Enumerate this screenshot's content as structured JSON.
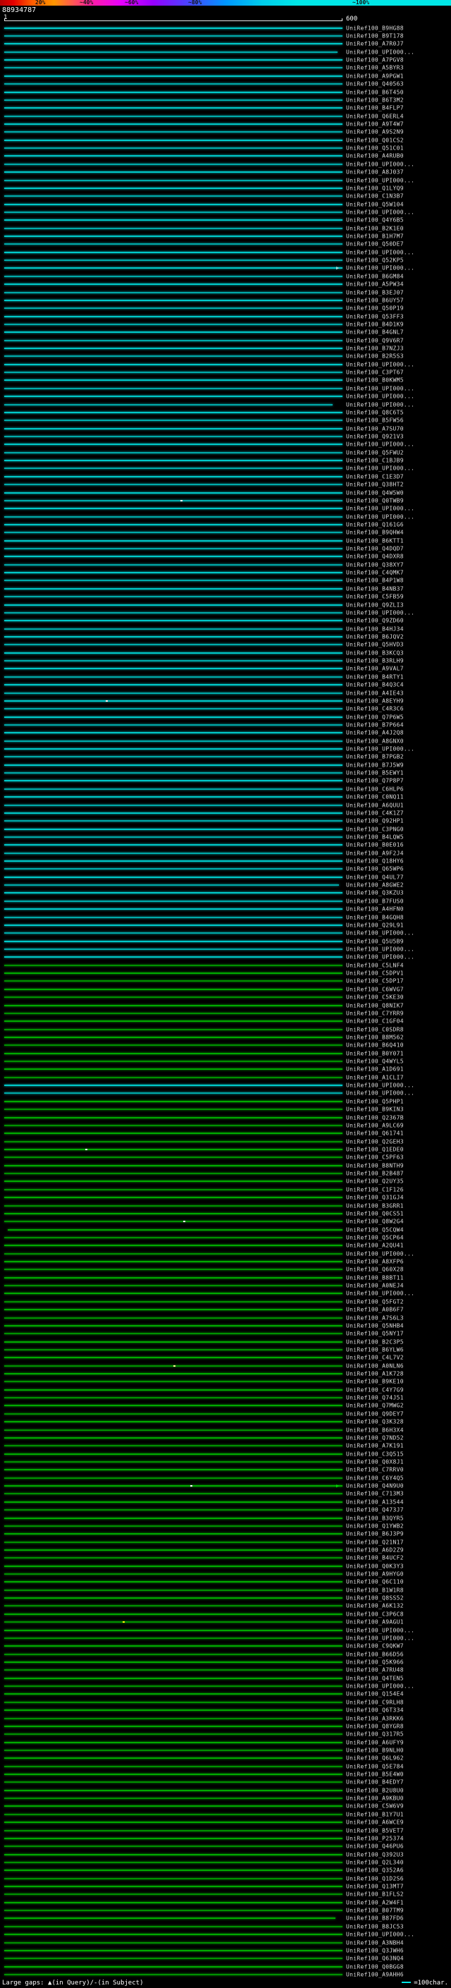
{
  "chart_data": {
    "type": "bar",
    "orientation": "horizontal",
    "title": "88934787",
    "x_range": [
      1,
      600
    ],
    "xlabel": "",
    "ylabel": "",
    "grid": false,
    "legend_position": "top",
    "scale_labels": [
      "20%",
      "~40%",
      "~60%",
      "~80%",
      "~100%"
    ],
    "colors": {
      "c": "#00c8c8",
      "g": "#00aa00"
    },
    "subject_prefix": "UniRef100_",
    "hits": [
      {
        "s": "B9HG88",
        "c": "c"
      },
      {
        "s": "B9T178",
        "c": "c"
      },
      {
        "s": "A7R0J7",
        "c": "c"
      },
      {
        "s": "UPI000...",
        "c": "c",
        "x1": 0.985
      },
      {
        "s": "A7PGV8",
        "c": "c"
      },
      {
        "s": "A5BYR3",
        "c": "c"
      },
      {
        "s": "A9PGW1",
        "c": "c"
      },
      {
        "s": "Q40563",
        "c": "c"
      },
      {
        "s": "B6T450",
        "c": "c"
      },
      {
        "s": "B6T3M2",
        "c": "c"
      },
      {
        "s": "B4FLP7",
        "c": "c"
      },
      {
        "s": "Q6ERL4",
        "c": "c"
      },
      {
        "s": "A9T4W7",
        "c": "c"
      },
      {
        "s": "A9S2N9",
        "c": "c"
      },
      {
        "s": "Q01CS2",
        "c": "c"
      },
      {
        "s": "Q51C01",
        "c": "c"
      },
      {
        "s": "A4RUB0",
        "c": "c"
      },
      {
        "s": "UPI000...",
        "c": "c"
      },
      {
        "s": "A8J037",
        "c": "c"
      },
      {
        "s": "UPI000...",
        "c": "c"
      },
      {
        "s": "Q1LYQ9",
        "c": "c"
      },
      {
        "s": "C1N3B7",
        "c": "c"
      },
      {
        "s": "Q5W104",
        "c": "c"
      },
      {
        "s": "UPI000...",
        "c": "c"
      },
      {
        "s": "Q4Y6B5",
        "c": "c"
      },
      {
        "s": "B2K1E0",
        "c": "c"
      },
      {
        "s": "B1H7M7",
        "c": "c"
      },
      {
        "s": "Q50DE7",
        "c": "c"
      },
      {
        "s": "UPI000...",
        "c": "c"
      },
      {
        "s": "Q52KP5",
        "c": "c"
      },
      {
        "s": "UPI000...",
        "c": "c",
        "m": "#a0e6e6"
      },
      {
        "s": "B6GM84",
        "c": "c"
      },
      {
        "s": "A5PW34",
        "c": "c"
      },
      {
        "s": "B3EJ07",
        "c": "c"
      },
      {
        "s": "B6UY57",
        "c": "c"
      },
      {
        "s": "Q50P19",
        "c": "c"
      },
      {
        "s": "Q53FF3",
        "c": "c"
      },
      {
        "s": "B4D1K9",
        "c": "c"
      },
      {
        "s": "B4GNL7",
        "c": "c"
      },
      {
        "s": "Q9V6R7",
        "c": "c"
      },
      {
        "s": "B7NZJ3",
        "c": "c"
      },
      {
        "s": "B2R5S3",
        "c": "c"
      },
      {
        "s": "UPI000...",
        "c": "c"
      },
      {
        "s": "C3PT67",
        "c": "c"
      },
      {
        "s": "B0KWM5",
        "c": "c"
      },
      {
        "s": "UPI000...",
        "c": "c"
      },
      {
        "s": "UPI000...",
        "c": "c"
      },
      {
        "s": "UPI000...",
        "c": "c",
        "x1": 0.97
      },
      {
        "s": "Q8C6T5",
        "c": "c"
      },
      {
        "s": "B5FW56",
        "c": "c"
      },
      {
        "s": "A7SU70",
        "c": "c"
      },
      {
        "s": "Q921V3",
        "c": "c"
      },
      {
        "s": "UPI000...",
        "c": "c"
      },
      {
        "s": "Q5FWU2",
        "c": "c"
      },
      {
        "s": "C1BJB9",
        "c": "c"
      },
      {
        "s": "UPI000...",
        "c": "c"
      },
      {
        "s": "C1E3D7",
        "c": "c"
      },
      {
        "s": "Q38HT2",
        "c": "c"
      },
      {
        "s": "Q4W5W0",
        "c": "c"
      },
      {
        "s": "Q0TWB9",
        "c": "c",
        "d": [
          [
            0.52,
            "#ffffff"
          ]
        ]
      },
      {
        "s": "UPI000...",
        "c": "c"
      },
      {
        "s": "UPI000...",
        "c": "c"
      },
      {
        "s": "Q161G6",
        "c": "c"
      },
      {
        "s": "B9QHW4",
        "c": "c"
      },
      {
        "s": "B6KTT1",
        "c": "c"
      },
      {
        "s": "Q4DQD7",
        "c": "c"
      },
      {
        "s": "Q4DXR8",
        "c": "c"
      },
      {
        "s": "Q38XY7",
        "c": "c"
      },
      {
        "s": "C4QMK7",
        "c": "c"
      },
      {
        "s": "B4P1W8",
        "c": "c"
      },
      {
        "s": "B4NB37",
        "c": "c"
      },
      {
        "s": "C5FB59",
        "c": "c"
      },
      {
        "s": "Q9ZLI3",
        "c": "c"
      },
      {
        "s": "UPI000...",
        "c": "c"
      },
      {
        "s": "Q9ZD60",
        "c": "c"
      },
      {
        "s": "B4HJ34",
        "c": "c"
      },
      {
        "s": "B6JQV2",
        "c": "c"
      },
      {
        "s": "Q5HVD3",
        "c": "c"
      },
      {
        "s": "B3KCQ3",
        "c": "c"
      },
      {
        "s": "B3RLH9",
        "c": "c"
      },
      {
        "s": "A9VAL7",
        "c": "c"
      },
      {
        "s": "B4RTY1",
        "c": "c"
      },
      {
        "s": "B4Q3C4",
        "c": "c"
      },
      {
        "s": "A4IE43",
        "c": "c"
      },
      {
        "s": "A8EYH9",
        "c": "c",
        "d": [
          [
            0.3,
            "#ffffff"
          ]
        ]
      },
      {
        "s": "C4R3C6",
        "c": "c"
      },
      {
        "s": "Q7P6W5",
        "c": "c"
      },
      {
        "s": "B7P664",
        "c": "c"
      },
      {
        "s": "A4J2Q8",
        "c": "c"
      },
      {
        "s": "A8GNX0",
        "c": "c"
      },
      {
        "s": "UPI000...",
        "c": "c"
      },
      {
        "s": "B7PGB2",
        "c": "c"
      },
      {
        "s": "B7J5W9",
        "c": "c"
      },
      {
        "s": "B5EWY1",
        "c": "c"
      },
      {
        "s": "Q7P8P7",
        "c": "c"
      },
      {
        "s": "C6HLP6",
        "c": "c"
      },
      {
        "s": "C0NQ11",
        "c": "c"
      },
      {
        "s": "A6QUU1",
        "c": "c"
      },
      {
        "s": "C4K1Z7",
        "c": "c"
      },
      {
        "s": "Q92HP1",
        "c": "c"
      },
      {
        "s": "C3PNG0",
        "c": "c"
      },
      {
        "s": "B4LQW5",
        "c": "c"
      },
      {
        "s": "B0E016",
        "c": "c"
      },
      {
        "s": "A9F2J4",
        "c": "c"
      },
      {
        "s": "Q18HY6",
        "c": "c"
      },
      {
        "s": "Q65WP6",
        "c": "c"
      },
      {
        "s": "Q4UL77",
        "c": "c"
      },
      {
        "s": "A8GWE2",
        "c": "c",
        "x1": 0.99
      },
      {
        "s": "Q3KZU3",
        "c": "c"
      },
      {
        "s": "B7FUS0",
        "c": "c"
      },
      {
        "s": "A4HFN0",
        "c": "c"
      },
      {
        "s": "B4GQH8",
        "c": "c"
      },
      {
        "s": "Q29L91",
        "c": "c"
      },
      {
        "s": "UPI000...",
        "c": "c"
      },
      {
        "s": "Q5U5B9",
        "c": "c"
      },
      {
        "s": "UPI000...",
        "c": "c"
      },
      {
        "s": "UPI000...",
        "c": "c"
      },
      {
        "s": "C5LNF4",
        "c": "g"
      },
      {
        "s": "C5DPV1",
        "c": "g"
      },
      {
        "s": "C5DP17",
        "c": "g"
      },
      {
        "s": "C6WVG7",
        "c": "g"
      },
      {
        "s": "C5KE30",
        "c": "g"
      },
      {
        "s": "Q8NIK7",
        "c": "g"
      },
      {
        "s": "C7YRR9",
        "c": "g"
      },
      {
        "s": "C1GF04",
        "c": "g"
      },
      {
        "s": "C0SDR8",
        "c": "g"
      },
      {
        "s": "B8M562",
        "c": "g"
      },
      {
        "s": "B6Q410",
        "c": "g"
      },
      {
        "s": "B0Y071",
        "c": "g"
      },
      {
        "s": "Q4WYL5",
        "c": "g"
      },
      {
        "s": "A1D691",
        "c": "g"
      },
      {
        "s": "A1CLI7",
        "c": "g"
      },
      {
        "s": "UPI000...",
        "c": "c"
      },
      {
        "s": "UPI000...",
        "c": "c"
      },
      {
        "s": "Q5PHP1",
        "c": "g"
      },
      {
        "s": "B9KIN3",
        "c": "g"
      },
      {
        "s": "Q2367B",
        "c": "g"
      },
      {
        "s": "A9LC69",
        "c": "g"
      },
      {
        "s": "Q61741",
        "c": "g"
      },
      {
        "s": "Q2GEH3",
        "c": "g"
      },
      {
        "s": "Q1EDE0",
        "c": "g",
        "d": [
          [
            0.24,
            "#ffffff"
          ]
        ]
      },
      {
        "s": "C5PF63",
        "c": "g"
      },
      {
        "s": "B8NTH9",
        "c": "g"
      },
      {
        "s": "B2B487",
        "c": "g"
      },
      {
        "s": "Q2UY35",
        "c": "g"
      },
      {
        "s": "C1F126",
        "c": "g"
      },
      {
        "s": "Q31GJ4",
        "c": "g"
      },
      {
        "s": "B3GRR1",
        "c": "g"
      },
      {
        "s": "Q0CS51",
        "c": "g"
      },
      {
        "s": "Q8W2G4",
        "c": "g",
        "d": [
          [
            0.53,
            "#ffffff"
          ]
        ]
      },
      {
        "s": "Q5CQW4",
        "c": "g",
        "x0": 0.01
      },
      {
        "s": "Q5CP64",
        "c": "g"
      },
      {
        "s": "A2QU41",
        "c": "g"
      },
      {
        "s": "UPI000...",
        "c": "g"
      },
      {
        "s": "A8XFP6",
        "c": "g"
      },
      {
        "s": "Q60X28",
        "c": "g"
      },
      {
        "s": "B8BT11",
        "c": "g"
      },
      {
        "s": "A0NEJ4",
        "c": "g"
      },
      {
        "s": "UPI000...",
        "c": "g"
      },
      {
        "s": "Q5FGT2",
        "c": "g"
      },
      {
        "s": "A0B6F7",
        "c": "g"
      },
      {
        "s": "A7S6L3",
        "c": "g"
      },
      {
        "s": "Q5NHB4",
        "c": "g"
      },
      {
        "s": "Q5NY17",
        "c": "g"
      },
      {
        "s": "B2C3P5",
        "c": "g"
      },
      {
        "s": "B6YLW6",
        "c": "g"
      },
      {
        "s": "C4L7V2",
        "c": "g"
      },
      {
        "s": "A0NLN6",
        "c": "g",
        "d": [
          [
            0.5,
            "#ffff99"
          ]
        ]
      },
      {
        "s": "A1K728",
        "c": "g"
      },
      {
        "s": "B9KE10",
        "c": "g"
      },
      {
        "s": "C4Y7G9",
        "c": "g"
      },
      {
        "s": "Q74J51",
        "c": "g"
      },
      {
        "s": "Q7MWG2",
        "c": "g"
      },
      {
        "s": "Q9DEY7",
        "c": "g"
      },
      {
        "s": "Q3K328",
        "c": "g"
      },
      {
        "s": "B6H3X4",
        "c": "g"
      },
      {
        "s": "Q7ND52",
        "c": "g"
      },
      {
        "s": "A7K191",
        "c": "g"
      },
      {
        "s": "C3Q515",
        "c": "g"
      },
      {
        "s": "Q0X8J1",
        "c": "g"
      },
      {
        "s": "C7RRV0",
        "c": "g"
      },
      {
        "s": "C6Y4Q5",
        "c": "g"
      },
      {
        "s": "Q4N9U0",
        "c": "g",
        "d": [
          [
            0.55,
            "#ffffff"
          ]
        ],
        "m": "#00dc00"
      },
      {
        "s": "C713M3",
        "c": "g"
      },
      {
        "s": "A13544",
        "c": "g"
      },
      {
        "s": "Q473J7",
        "c": "g"
      },
      {
        "s": "B3QYR5",
        "c": "g"
      },
      {
        "s": "Q1YWB2",
        "c": "g"
      },
      {
        "s": "B6J3P9",
        "c": "g"
      },
      {
        "s": "Q21N17",
        "c": "g"
      },
      {
        "s": "A6D2Z9",
        "c": "g"
      },
      {
        "s": "B4UCF2",
        "c": "g"
      },
      {
        "s": "Q0K3Y3",
        "c": "g"
      },
      {
        "s": "A9HYG0",
        "c": "g"
      },
      {
        "s": "Q6C110",
        "c": "g"
      },
      {
        "s": "B1W1R8",
        "c": "g"
      },
      {
        "s": "Q8SS52",
        "c": "g"
      },
      {
        "s": "A6K132",
        "c": "g"
      },
      {
        "s": "C3P6C8",
        "c": "g"
      },
      {
        "s": "A9AGU1",
        "c": "g",
        "d": [
          [
            0.35,
            "#ffff00"
          ]
        ]
      },
      {
        "s": "UPI000...",
        "c": "g"
      },
      {
        "s": "UPI000...",
        "c": "g"
      },
      {
        "s": "C9QKW7",
        "c": "g"
      },
      {
        "s": "B66D56",
        "c": "g"
      },
      {
        "s": "Q5K966",
        "c": "g"
      },
      {
        "s": "A7RU48",
        "c": "g"
      },
      {
        "s": "Q4TEN5",
        "c": "g"
      },
      {
        "s": "UPI000...",
        "c": "g"
      },
      {
        "s": "Q154E4",
        "c": "g"
      },
      {
        "s": "C9RLH8",
        "c": "g"
      },
      {
        "s": "Q6T334",
        "c": "g"
      },
      {
        "s": "A3RKK6",
        "c": "g"
      },
      {
        "s": "Q8YGR8",
        "c": "g"
      },
      {
        "s": "Q317R5",
        "c": "g"
      },
      {
        "s": "A6UFY9",
        "c": "g"
      },
      {
        "s": "B9NLH0",
        "c": "g"
      },
      {
        "s": "Q6L962",
        "c": "g"
      },
      {
        "s": "Q5E784",
        "c": "g"
      },
      {
        "s": "B5E4W0",
        "c": "g"
      },
      {
        "s": "B4EDY7",
        "c": "g"
      },
      {
        "s": "B2U8U0",
        "c": "g"
      },
      {
        "s": "A9KBU0",
        "c": "g"
      },
      {
        "s": "C5W6V9",
        "c": "g"
      },
      {
        "s": "B1Y7U1",
        "c": "g"
      },
      {
        "s": "A6WCE9",
        "c": "g"
      },
      {
        "s": "B5VET7",
        "c": "g"
      },
      {
        "s": "P25374",
        "c": "g"
      },
      {
        "s": "Q46PU6",
        "c": "g"
      },
      {
        "s": "Q392U3",
        "c": "g"
      },
      {
        "s": "Q2L340",
        "c": "g"
      },
      {
        "s": "Q352A6",
        "c": "g"
      },
      {
        "s": "Q1D2S6",
        "c": "g"
      },
      {
        "s": "Q13MT7",
        "c": "g"
      },
      {
        "s": "B1FLS2",
        "c": "g"
      },
      {
        "s": "A2W4F1",
        "c": "g"
      },
      {
        "s": "B07TM9",
        "c": "g"
      },
      {
        "s": "B87FD6",
        "c": "g",
        "x1": 0.98
      },
      {
        "s": "B8JC53",
        "c": "g"
      },
      {
        "s": "UPI000...",
        "c": "g"
      },
      {
        "s": "A3NBH4",
        "c": "g"
      },
      {
        "s": "Q3JWH6",
        "c": "g"
      },
      {
        "s": "Q63NQ4",
        "c": "g"
      },
      {
        "s": "Q0BGG8",
        "c": "g"
      },
      {
        "s": "A9AHH6",
        "c": "g"
      }
    ]
  },
  "footer": {
    "gaps_label": "Large gaps: ▲(in Query)/-(in Subject)",
    "legend_text": "=100char."
  }
}
